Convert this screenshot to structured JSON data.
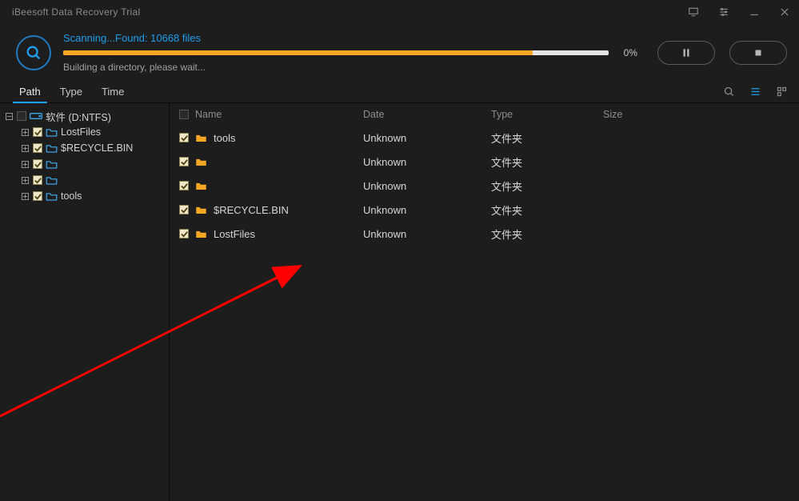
{
  "titlebar": {
    "title": "iBeesoft Data Recovery Trial"
  },
  "scan": {
    "status_line": "Scanning...Found: 10668 files",
    "sub_line": "Building a directory, please wait...",
    "percent_label": "0%",
    "progress_percent": 86
  },
  "tabs": {
    "items": [
      {
        "key": "path",
        "label": "Path",
        "active": true
      },
      {
        "key": "type",
        "label": "Type",
        "active": false
      },
      {
        "key": "time",
        "label": "Time",
        "active": false
      }
    ]
  },
  "tree": {
    "root": {
      "label": "软件 (D:NTFS)"
    },
    "children": [
      {
        "label": "LostFiles"
      },
      {
        "label": "$RECYCLE.BIN"
      },
      {
        "label": ""
      },
      {
        "label": ""
      },
      {
        "label": "tools"
      }
    ]
  },
  "columns": {
    "name": "Name",
    "date": "Date",
    "type": "Type",
    "size": "Size"
  },
  "rows": [
    {
      "name": "tools",
      "date": "Unknown",
      "type": "文件夹",
      "size": ""
    },
    {
      "name": "",
      "date": "Unknown",
      "type": "文件夹",
      "size": ""
    },
    {
      "name": "",
      "date": "Unknown",
      "type": "文件夹",
      "size": ""
    },
    {
      "name": "$RECYCLE.BIN",
      "date": "Unknown",
      "type": "文件夹",
      "size": ""
    },
    {
      "name": "LostFiles",
      "date": "Unknown",
      "type": "文件夹",
      "size": ""
    }
  ]
}
